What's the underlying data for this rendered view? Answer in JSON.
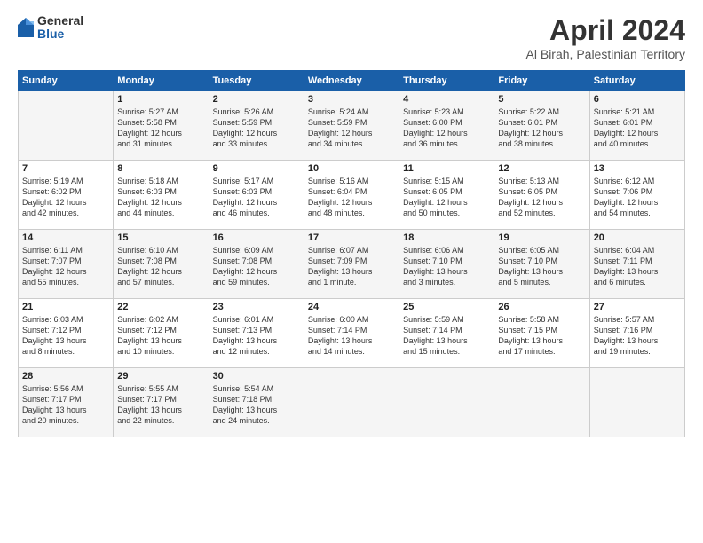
{
  "logo": {
    "general": "General",
    "blue": "Blue"
  },
  "title": "April 2024",
  "location": "Al Birah, Palestinian Territory",
  "headers": [
    "Sunday",
    "Monday",
    "Tuesday",
    "Wednesday",
    "Thursday",
    "Friday",
    "Saturday"
  ],
  "weeks": [
    [
      {
        "day": "",
        "info": ""
      },
      {
        "day": "1",
        "info": "Sunrise: 5:27 AM\nSunset: 5:58 PM\nDaylight: 12 hours\nand 31 minutes."
      },
      {
        "day": "2",
        "info": "Sunrise: 5:26 AM\nSunset: 5:59 PM\nDaylight: 12 hours\nand 33 minutes."
      },
      {
        "day": "3",
        "info": "Sunrise: 5:24 AM\nSunset: 5:59 PM\nDaylight: 12 hours\nand 34 minutes."
      },
      {
        "day": "4",
        "info": "Sunrise: 5:23 AM\nSunset: 6:00 PM\nDaylight: 12 hours\nand 36 minutes."
      },
      {
        "day": "5",
        "info": "Sunrise: 5:22 AM\nSunset: 6:01 PM\nDaylight: 12 hours\nand 38 minutes."
      },
      {
        "day": "6",
        "info": "Sunrise: 5:21 AM\nSunset: 6:01 PM\nDaylight: 12 hours\nand 40 minutes."
      }
    ],
    [
      {
        "day": "7",
        "info": "Sunrise: 5:19 AM\nSunset: 6:02 PM\nDaylight: 12 hours\nand 42 minutes."
      },
      {
        "day": "8",
        "info": "Sunrise: 5:18 AM\nSunset: 6:03 PM\nDaylight: 12 hours\nand 44 minutes."
      },
      {
        "day": "9",
        "info": "Sunrise: 5:17 AM\nSunset: 6:03 PM\nDaylight: 12 hours\nand 46 minutes."
      },
      {
        "day": "10",
        "info": "Sunrise: 5:16 AM\nSunset: 6:04 PM\nDaylight: 12 hours\nand 48 minutes."
      },
      {
        "day": "11",
        "info": "Sunrise: 5:15 AM\nSunset: 6:05 PM\nDaylight: 12 hours\nand 50 minutes."
      },
      {
        "day": "12",
        "info": "Sunrise: 5:13 AM\nSunset: 6:05 PM\nDaylight: 12 hours\nand 52 minutes."
      },
      {
        "day": "13",
        "info": "Sunrise: 6:12 AM\nSunset: 7:06 PM\nDaylight: 12 hours\nand 54 minutes."
      }
    ],
    [
      {
        "day": "14",
        "info": "Sunrise: 6:11 AM\nSunset: 7:07 PM\nDaylight: 12 hours\nand 55 minutes."
      },
      {
        "day": "15",
        "info": "Sunrise: 6:10 AM\nSunset: 7:08 PM\nDaylight: 12 hours\nand 57 minutes."
      },
      {
        "day": "16",
        "info": "Sunrise: 6:09 AM\nSunset: 7:08 PM\nDaylight: 12 hours\nand 59 minutes."
      },
      {
        "day": "17",
        "info": "Sunrise: 6:07 AM\nSunset: 7:09 PM\nDaylight: 13 hours\nand 1 minute."
      },
      {
        "day": "18",
        "info": "Sunrise: 6:06 AM\nSunset: 7:10 PM\nDaylight: 13 hours\nand 3 minutes."
      },
      {
        "day": "19",
        "info": "Sunrise: 6:05 AM\nSunset: 7:10 PM\nDaylight: 13 hours\nand 5 minutes."
      },
      {
        "day": "20",
        "info": "Sunrise: 6:04 AM\nSunset: 7:11 PM\nDaylight: 13 hours\nand 6 minutes."
      }
    ],
    [
      {
        "day": "21",
        "info": "Sunrise: 6:03 AM\nSunset: 7:12 PM\nDaylight: 13 hours\nand 8 minutes."
      },
      {
        "day": "22",
        "info": "Sunrise: 6:02 AM\nSunset: 7:12 PM\nDaylight: 13 hours\nand 10 minutes."
      },
      {
        "day": "23",
        "info": "Sunrise: 6:01 AM\nSunset: 7:13 PM\nDaylight: 13 hours\nand 12 minutes."
      },
      {
        "day": "24",
        "info": "Sunrise: 6:00 AM\nSunset: 7:14 PM\nDaylight: 13 hours\nand 14 minutes."
      },
      {
        "day": "25",
        "info": "Sunrise: 5:59 AM\nSunset: 7:14 PM\nDaylight: 13 hours\nand 15 minutes."
      },
      {
        "day": "26",
        "info": "Sunrise: 5:58 AM\nSunset: 7:15 PM\nDaylight: 13 hours\nand 17 minutes."
      },
      {
        "day": "27",
        "info": "Sunrise: 5:57 AM\nSunset: 7:16 PM\nDaylight: 13 hours\nand 19 minutes."
      }
    ],
    [
      {
        "day": "28",
        "info": "Sunrise: 5:56 AM\nSunset: 7:17 PM\nDaylight: 13 hours\nand 20 minutes."
      },
      {
        "day": "29",
        "info": "Sunrise: 5:55 AM\nSunset: 7:17 PM\nDaylight: 13 hours\nand 22 minutes."
      },
      {
        "day": "30",
        "info": "Sunrise: 5:54 AM\nSunset: 7:18 PM\nDaylight: 13 hours\nand 24 minutes."
      },
      {
        "day": "",
        "info": ""
      },
      {
        "day": "",
        "info": ""
      },
      {
        "day": "",
        "info": ""
      },
      {
        "day": "",
        "info": ""
      }
    ]
  ]
}
